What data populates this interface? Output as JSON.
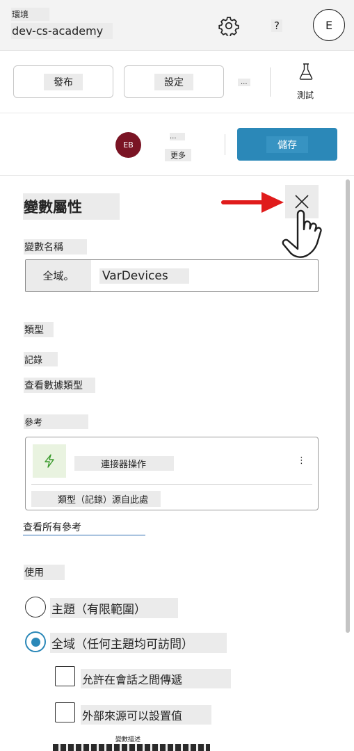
{
  "env": {
    "label": "環境",
    "name": "dev-cs-academy",
    "help": "?",
    "avatar_initial": "E",
    "settings_icon": "gear-icon"
  },
  "toolbar": {
    "publish": "發布",
    "settings": "設定",
    "more": "...",
    "test": "測試",
    "test_icon": "flask-icon"
  },
  "savebar": {
    "avatar": "EB",
    "more_ellipsis": "...",
    "more_label": "更多",
    "save": "儲存"
  },
  "panel": {
    "title": "變數屬性",
    "name_label": "變數名稱",
    "scope_tag": "全域。",
    "name_value": "VarDevices",
    "type_label": "類型",
    "type_value": "記錄",
    "view_schema": "查看數據類型",
    "refs_label": "參考",
    "ref_title": "連接器操作",
    "ref_dots": "⋮",
    "ref_sub": "類型（記錄）源自此處",
    "view_all": "查看所有參考",
    "usage_label": "使用",
    "option_topic": "主題（有限範圍）",
    "option_global": "全域（任何主題均可訪問）",
    "check_carry": "允許在會話之間傳遞",
    "check_external": "外部來源可以設置值",
    "description_label": "變數描述"
  },
  "colors": {
    "accent": "#2b88b8",
    "avatar_eb": "#7a1424",
    "arrow": "#e01b1b",
    "bolt_bg": "#e9f3e0"
  }
}
